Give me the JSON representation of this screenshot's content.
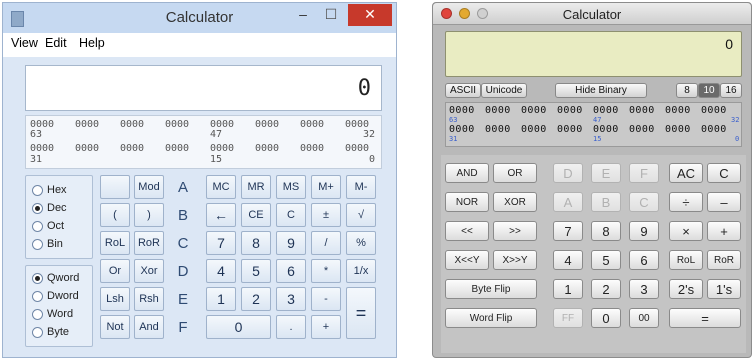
{
  "win": {
    "title": "Calculator",
    "titlebar_buttons": [
      "–",
      "☐",
      "✕"
    ],
    "menu": [
      "View",
      "Edit",
      "Help"
    ],
    "display": "0",
    "binary": {
      "row1": [
        "0000",
        "0000",
        "0000",
        "0000",
        "0000",
        "0000",
        "0000",
        "0000"
      ],
      "row1_labels": [
        "63",
        "47",
        "32"
      ],
      "row2": [
        "0000",
        "0000",
        "0000",
        "0000",
        "0000",
        "0000",
        "0000",
        "0000"
      ],
      "row2_labels": [
        "31",
        "15",
        "0"
      ]
    },
    "base_options": [
      "Hex",
      "Dec",
      "Oct",
      "Bin"
    ],
    "base_selected": "Dec",
    "word_options": [
      "Qword",
      "Dword",
      "Word",
      "Byte"
    ],
    "word_selected": "Qword",
    "buttons": {
      "r1": [
        "",
        "Mod",
        "A",
        "MC",
        "MR",
        "MS",
        "M+",
        "M-"
      ],
      "r2": [
        "(",
        ")",
        "B",
        "←",
        "CE",
        "C",
        "±",
        "√"
      ],
      "r3": [
        "RoL",
        "RoR",
        "C",
        "7",
        "8",
        "9",
        "/",
        "%"
      ],
      "r4": [
        "Or",
        "Xor",
        "D",
        "4",
        "5",
        "6",
        "*",
        "1/x"
      ],
      "r5": [
        "Lsh",
        "Rsh",
        "E",
        "1",
        "2",
        "3",
        "-",
        "="
      ],
      "r6": [
        "Not",
        "And",
        "F",
        "0",
        ".",
        "+"
      ]
    }
  },
  "mac": {
    "title": "Calculator",
    "display": "0",
    "modes": [
      "ASCII",
      "Unicode"
    ],
    "hide_binary": "Hide Binary",
    "bases": [
      "8",
      "10",
      "16"
    ],
    "base_selected": "10",
    "binary": {
      "row1": [
        "0000",
        "0000",
        "0000",
        "0000",
        "0000",
        "0000",
        "0000",
        "0000"
      ],
      "row1_labels": [
        "63",
        "47",
        "32"
      ],
      "row2": [
        "0000",
        "0000",
        "0000",
        "0000",
        "0000",
        "0000",
        "0000",
        "0000"
      ],
      "row2_labels": [
        "31",
        "15",
        "0"
      ]
    },
    "keys": {
      "r1": [
        "AND",
        "OR",
        "D",
        "E",
        "F",
        "AC",
        "C"
      ],
      "r2": [
        "NOR",
        "XOR",
        "A",
        "B",
        "C",
        "÷",
        "–"
      ],
      "r3": [
        "<<",
        ">>",
        "7",
        "8",
        "9",
        "×",
        "+"
      ],
      "r4": [
        "X<<Y",
        "X>>Y",
        "4",
        "5",
        "6",
        "RoL",
        "RoR"
      ],
      "r5": [
        "Byte Flip",
        "1",
        "2",
        "3",
        "2's",
        "1's"
      ],
      "r6": [
        "Word Flip",
        "FF",
        "0",
        "00",
        "="
      ]
    }
  }
}
